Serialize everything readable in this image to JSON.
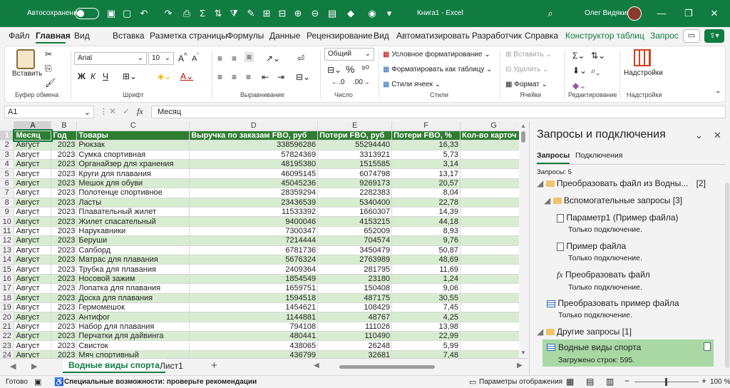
{
  "titlebar": {
    "autosave_label": "Автосохранение",
    "doc_title": "Книга1 - Excel",
    "user_name": "Олег Видякин"
  },
  "tabs": [
    "Файл",
    "Главная",
    "Вид",
    "Вставка",
    "Разметка страницы",
    "Формулы",
    "Данные",
    "Рецензирование",
    "Вид",
    "Автоматизировать",
    "Разработчик",
    "Справка",
    "Конструктор таблиц",
    "Запрос"
  ],
  "ribbon": {
    "paste": "Вставить",
    "clipboard_group": "Буфер обмена",
    "font_name": "Arial",
    "font_size": "10",
    "font_group": "Шрифт",
    "bold": "Ж",
    "italic": "К",
    "underline": "Ч",
    "alignment_group": "Выравнивание",
    "number_format": "Общий",
    "number_group": "Число",
    "cond_format": "Условное форматирование",
    "format_table": "Форматировать как таблицу",
    "cell_styles": "Стили ячеек",
    "styles_group": "Стили",
    "insert": "Вставить",
    "delete": "Удалить",
    "format": "Формат",
    "cells_group": "Ячейки",
    "editing_group": "Редактирование",
    "addins": "Надстройки",
    "addins_group": "Надстройки"
  },
  "formula": {
    "cell_ref": "A1",
    "fx": "fx",
    "value": "Месяц"
  },
  "grid": {
    "columns": [
      "A",
      "B",
      "C",
      "D",
      "E",
      "F",
      "G"
    ],
    "headers": [
      "Месяц",
      "Год",
      "Товары",
      "Выручка по заказам FBO, руб",
      "Потери FBO, руб",
      "Потери FBO, %",
      "Кол-во карточ"
    ],
    "rows": [
      [
        "Август",
        "2023",
        "Рюкзак",
        "338596286",
        "55294440",
        "16,33"
      ],
      [
        "Август",
        "2023",
        "Сумка спортивная",
        "57824369",
        "3313921",
        "5,73"
      ],
      [
        "Август",
        "2023",
        "Органайзер для хранения",
        "48195380",
        "1515585",
        "3,14"
      ],
      [
        "Август",
        "2023",
        "Круги для плавания",
        "46095145",
        "6074798",
        "13,17"
      ],
      [
        "Август",
        "2023",
        "Мешок для обуви",
        "45045236",
        "9269173",
        "20,57"
      ],
      [
        "Август",
        "2023",
        "Полотенце спортивное",
        "28359294",
        "2282383",
        "8,04"
      ],
      [
        "Август",
        "2023",
        "Ласты",
        "23436539",
        "5340400",
        "22,78"
      ],
      [
        "Август",
        "2023",
        "Плавательный жилет",
        "11533392",
        "1660307",
        "14,39"
      ],
      [
        "Август",
        "2023",
        "Жилет спасательный",
        "9400046",
        "4153215",
        "44,18"
      ],
      [
        "Август",
        "2023",
        "Нарукавники",
        "7300347",
        "652009",
        "8,93"
      ],
      [
        "Август",
        "2023",
        "Беруши",
        "7214444",
        "704574",
        "9,76"
      ],
      [
        "Август",
        "2023",
        "Сапборд",
        "6781736",
        "3450479",
        "50,87"
      ],
      [
        "Август",
        "2023",
        "Матрас для плавания",
        "5676324",
        "2763989",
        "48,69"
      ],
      [
        "Август",
        "2023",
        "Трубка для плавания",
        "2409364",
        "281795",
        "11,69"
      ],
      [
        "Август",
        "2023",
        "Носовой зажим",
        "1854549",
        "23180",
        "1,24"
      ],
      [
        "Август",
        "2023",
        "Лопатка для плавания",
        "1659751",
        "150408",
        "9,06"
      ],
      [
        "Август",
        "2023",
        "Доска для плавания",
        "1594518",
        "487175",
        "30,55"
      ],
      [
        "Август",
        "2023",
        "Гермомешок",
        "1454621",
        "108429",
        "7,45"
      ],
      [
        "Август",
        "2023",
        "Антифог",
        "1144881",
        "48767",
        "4,25"
      ],
      [
        "Август",
        "2023",
        "Набор для плавания",
        "794108",
        "111026",
        "13,98"
      ],
      [
        "Август",
        "2023",
        "Перчатки для дайвинга",
        "480441",
        "110490",
        "22,99"
      ],
      [
        "Август",
        "2023",
        "Свисток",
        "438065",
        "26248",
        "5,99"
      ],
      [
        "Август",
        "2023",
        "Мяч спортивный",
        "436799",
        "32681",
        "7,48"
      ]
    ]
  },
  "sheets": {
    "active": "Водные виды спорта",
    "other": "Лист1",
    "add": "+"
  },
  "status": {
    "ready": "Готово",
    "accessibility": "Специальные возможности: проверьте рекомендации",
    "display": "Параметры отображения",
    "zoom": "100 %"
  },
  "pane": {
    "title": "Запросы и подключения",
    "tab_queries": "Запросы",
    "tab_connections": "Подключения",
    "count": "Запросы: 5",
    "items": {
      "transform_file": "Преобразовать файл из Водны...",
      "transform_file_count": "[2]",
      "helper": "Вспомогательные запросы",
      "helper_count": "[3]",
      "param": "Параметр1 (Пример файла)",
      "conn_only": "Только подключение.",
      "sample": "Пример файла",
      "transform": "Преобразовать файл",
      "transform_sample": "Преобразовать пример файла",
      "other": "Другие запросы",
      "other_count": "[1]",
      "water": "Водные виды спорта",
      "loaded": "Загружено строк: 595."
    }
  }
}
